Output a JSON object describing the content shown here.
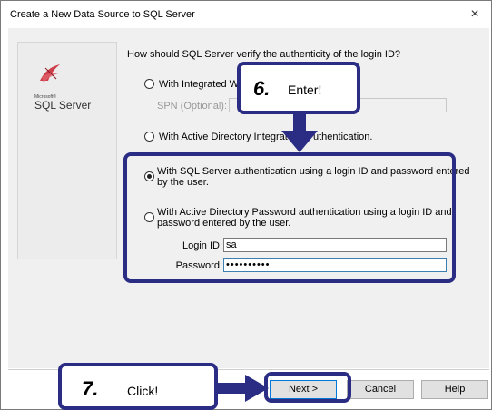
{
  "window": {
    "title": "Create a New Data Source to SQL Server",
    "close_symbol": "×"
  },
  "logo": {
    "small_text": "Microsoft®",
    "text": "SQL Server"
  },
  "question": "How should SQL Server verify the authenticity of the login ID?",
  "options": {
    "integrated_label": "With Integrated Wi",
    "spn_label": "SPN (Optional):",
    "ad_integrated_label": "With Active Directory Integrated ",
    "ad_integrated_label_tail": "uthentication.",
    "sql_auth_line1": "With SQL Server authentication using a login ID and password entered",
    "sql_auth_line2": "by the user.",
    "ad_password_line1": "With Active Directory Password authentication using a login ID and",
    "ad_password_line2": "password entered by the user."
  },
  "fields": {
    "login_label": "Login ID:",
    "login_value": "sa",
    "password_label": "Password:",
    "password_value": "••••••••••"
  },
  "buttons": {
    "next": "Next >",
    "cancel": "Cancel",
    "help": "Help"
  },
  "callouts": {
    "step6_num": "6.",
    "step6_word": "Enter!",
    "step7_num": "7.",
    "step7_word": "Click!"
  },
  "colors": {
    "annotation": "#2b2d85",
    "logo_red": "#c8202e"
  }
}
